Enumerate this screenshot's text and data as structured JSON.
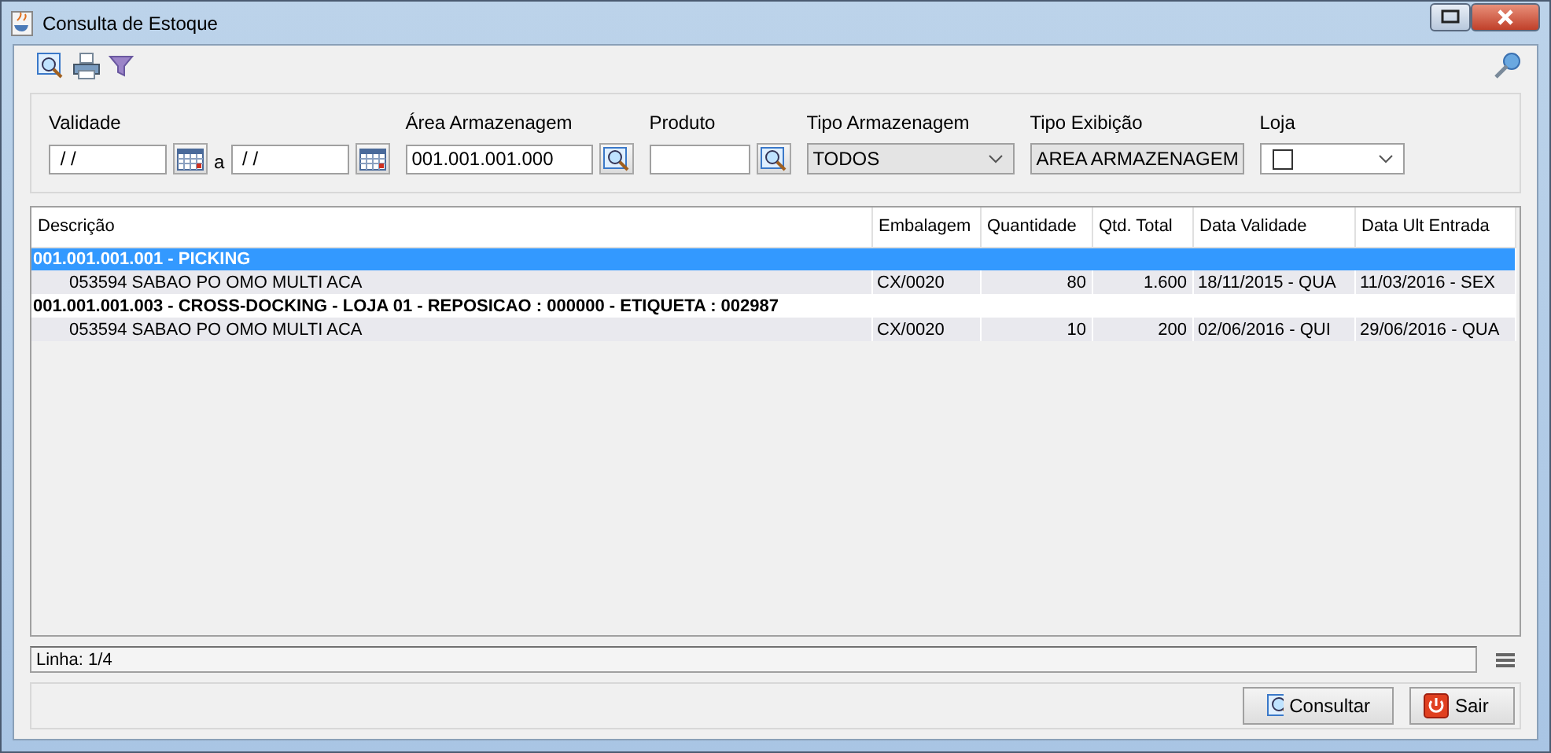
{
  "window": {
    "title": "Consulta de Estoque"
  },
  "filters": {
    "validade": {
      "label": "Validade",
      "from": " / /",
      "separator": "a",
      "to": " / /"
    },
    "area": {
      "label": "Área Armazenagem",
      "value": "001.001.001.000"
    },
    "produto": {
      "label": "Produto"
    },
    "tipo_armazenagem": {
      "label": "Tipo Armazenagem",
      "value": "TODOS"
    },
    "tipo_exibicao": {
      "label": "Tipo Exibição",
      "value": "AREA ARMAZENAGEM"
    },
    "loja": {
      "label": "Loja",
      "checked": false
    }
  },
  "table": {
    "columns": [
      "Descrição",
      "Embalagem",
      "Quantidade",
      "Qtd. Total",
      "Data Validade",
      "Data Ult Entrada"
    ],
    "rows": [
      {
        "kind": "group",
        "selected": true,
        "text": "001.001.001.001 - PICKING"
      },
      {
        "kind": "item",
        "selected": false,
        "cells": [
          "053594  SABAO PO OMO MULTI ACA",
          "CX/0020",
          "80",
          "1.600",
          "18/11/2015 - QUA",
          "11/03/2016 - SEX"
        ]
      },
      {
        "kind": "group",
        "selected": false,
        "text": "001.001.001.003 - CROSS-DOCKING - LOJA 01 - REPOSICAO : 000000 - ETIQUETA : 002987"
      },
      {
        "kind": "item",
        "selected": false,
        "cells": [
          "053594  SABAO PO OMO MULTI ACA",
          "CX/0020",
          "10",
          "200",
          "02/06/2016 - QUI",
          "29/06/2016 - QUA"
        ]
      }
    ]
  },
  "status_bar": "Linha: 1/4",
  "buttons": [
    {
      "kind": "search",
      "label": "Consultar"
    },
    {
      "kind": "exit",
      "label": "Sair"
    }
  ]
}
